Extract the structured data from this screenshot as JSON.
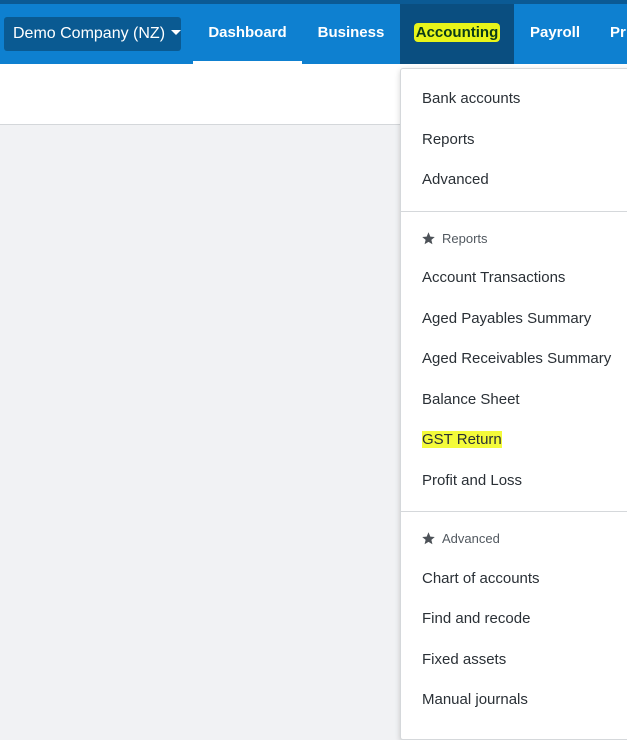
{
  "topbar": {
    "org_name": "Demo Company (NZ)",
    "nav": {
      "dashboard": "Dashboard",
      "business": "Business",
      "accounting": "Accounting",
      "payroll": "Payroll",
      "more": "Pr"
    }
  },
  "accounting_menu": {
    "top_items": [
      "Bank accounts",
      "Reports",
      "Advanced"
    ],
    "reports_section": {
      "title": "Reports",
      "icon": "star-icon",
      "items": [
        "Account Transactions",
        "Aged Payables Summary",
        "Aged Receivables Summary",
        "Balance Sheet",
        "GST Return",
        "Profit and Loss"
      ]
    },
    "advanced_section": {
      "title": "Advanced",
      "icon": "star-icon",
      "items": [
        "Chart of accounts",
        "Find and recode",
        "Fixed assets",
        "Manual journals"
      ]
    }
  },
  "colors": {
    "nav_background": "#0e80d0",
    "nav_active": "#0a4e80",
    "org_button": "#0a5a92",
    "highlight": "#f4fb3a"
  }
}
